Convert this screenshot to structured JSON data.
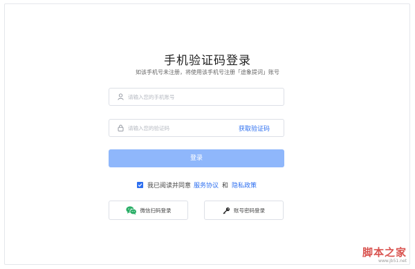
{
  "page": {
    "title": "手机验证码登录",
    "subtitle": "如该手机号未注册，将使用该手机号注册「途象提词」账号"
  },
  "form": {
    "phone_placeholder": "请输入您的手机账号",
    "code_placeholder": "请输入您的验证码",
    "get_code_label": "获取验证码",
    "login_label": "登录"
  },
  "agreement": {
    "text": "我已阅读并同意",
    "terms_label": "服务协议",
    "and_label": "和",
    "privacy_label": "隐私政策",
    "checked": true
  },
  "alt_login": {
    "wechat_label": "微信扫码登录",
    "password_label": "账号密码登录"
  },
  "watermark": {
    "brand": "脚本之家",
    "url": "www.jb51.net"
  },
  "colors": {
    "accent": "#2d6ff0",
    "login_button": "#8fb7fb",
    "wechat": "#2aae67",
    "border": "#dcdfe6"
  }
}
